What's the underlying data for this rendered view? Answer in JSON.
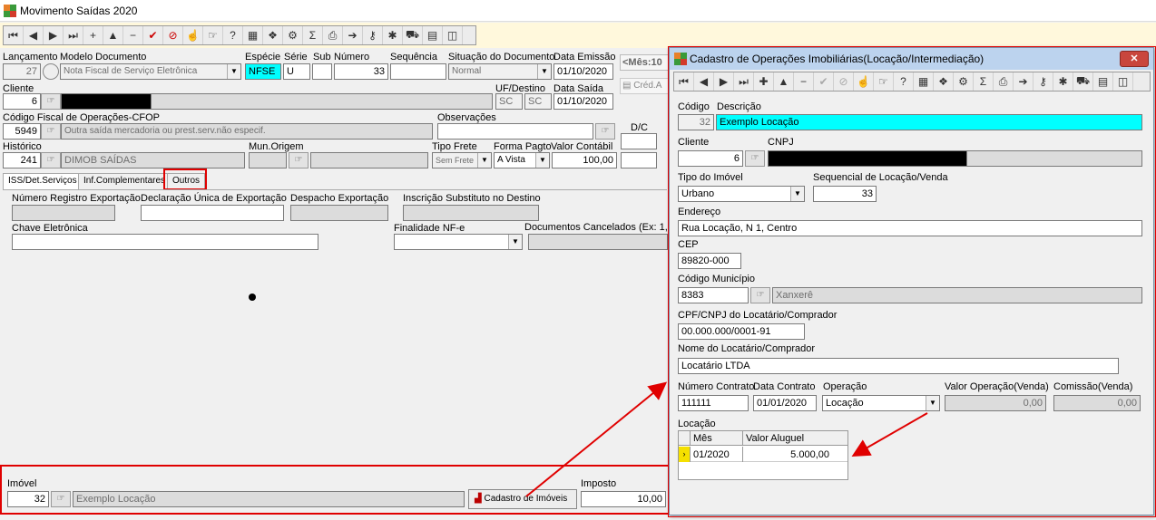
{
  "main": {
    "title": "Movimento Saídas 2020",
    "lancamento": {
      "label": "Lançamento",
      "value": "27"
    },
    "modelo": {
      "label": "Modelo Documento",
      "value": "Nota Fiscal de Serviço Eletrônica"
    },
    "especie": {
      "label": "Espécie",
      "value": "NFSE"
    },
    "serie": {
      "label": "Série",
      "value": "U"
    },
    "sub": {
      "label": "Sub",
      "value": ""
    },
    "numero": {
      "label": "Número",
      "value": "33"
    },
    "sequencia": {
      "label": "Sequência",
      "value": ""
    },
    "situacao": {
      "label": "Situação do Documento",
      "value": "Normal"
    },
    "data_emissao": {
      "label": "Data Emissão",
      "value": "01/10/2020"
    },
    "mes": "<Mês:10",
    "cliente": {
      "label": "Cliente",
      "value": "6"
    },
    "uf": {
      "label": "UF/Destino",
      "value1": "SC",
      "value2": "SC"
    },
    "data_saida": {
      "label": "Data Saída",
      "value": "01/10/2020"
    },
    "cred": "Créd.A",
    "cfop": {
      "label": "Código Fiscal de Operações-CFOP",
      "code": "5949",
      "desc": "Outra saída mercadoria ou prest.serv.não especif."
    },
    "observacoes": {
      "label": "Observações"
    },
    "dc": "D/C",
    "historico": {
      "label": "Histórico",
      "code": "241",
      "desc": "DIMOB SAÍDAS"
    },
    "mun_origem": {
      "label": "Mun.Origem"
    },
    "tipo_frete": {
      "label": "Tipo Frete",
      "value": "Sem Frete"
    },
    "forma_pagto": {
      "label": "Forma Pagto",
      "value": "A Vista"
    },
    "valor_contabil": {
      "label": "Valor Contábil",
      "value": "100,00"
    },
    "tabs": [
      "ISS/Det.Serviços",
      "Inf.Complementares",
      "Outros"
    ],
    "outros": {
      "num_reg_exp": "Número Registro Exportação",
      "decl_unica": "Declaração Única de Exportação",
      "despacho": "Despacho Exportação",
      "insc_subst": "Inscrição Substituto no Destino",
      "chave": "Chave Eletrônica",
      "finalidade": "Finalidade NF-e",
      "doc_cancel": "Documentos Cancelados  (Ex: 1,"
    },
    "imovel": {
      "label": "Imóvel",
      "code": "32",
      "desc": "Exemplo Locação"
    },
    "cadastro_btn": "Cadastro de Imóveis",
    "imposto": {
      "label": "Imposto",
      "value": "10,00"
    }
  },
  "dialog": {
    "title": "Cadastro de Operações Imobiliárias(Locação/Intermediação)",
    "codigo": {
      "label": "Código",
      "value": "32"
    },
    "descricao": {
      "label": "Descrição",
      "value": "Exemplo Locação"
    },
    "cliente": {
      "label": "Cliente",
      "value": "6"
    },
    "cnpj": {
      "label": "CNPJ"
    },
    "tipo_imovel": {
      "label": "Tipo do Imóvel",
      "value": "Urbano"
    },
    "seq_locacao": {
      "label": "Sequencial de Locação/Venda",
      "value": "33"
    },
    "endereco": {
      "label": "Endereço",
      "value": "Rua Locação, N 1, Centro"
    },
    "cep": {
      "label": "CEP",
      "value": "89820-000"
    },
    "cod_municipio": {
      "label": "Código Município",
      "value": "8383",
      "name": "Xanxerê"
    },
    "cpf_cnpj": {
      "label": "CPF/CNPJ do Locatário/Comprador",
      "value": "00.000.000/0001-91"
    },
    "nome_locatario": {
      "label": "Nome do Locatário/Comprador",
      "value": "Locatário LTDA"
    },
    "num_contrato": {
      "label": "Número Contrato",
      "value": "111111"
    },
    "data_contrato": {
      "label": "Data Contrato",
      "value": "01/01/2020"
    },
    "operacao": {
      "label": "Operação",
      "value": "Locação"
    },
    "valor_operacao": {
      "label": "Valor Operação(Venda)",
      "value": "0,00"
    },
    "comissao": {
      "label": "Comissão(Venda)",
      "value": "0,00"
    },
    "locacao": {
      "label": "Locação",
      "cols": [
        "Mês",
        "Valor Aluguel"
      ],
      "rows": [
        [
          "01/2020",
          "5.000,00"
        ]
      ]
    }
  },
  "colors": {
    "accent_cyan": "#00ffff",
    "highlight_red": "#e00000",
    "dialog_title": "#bcd3ee"
  }
}
